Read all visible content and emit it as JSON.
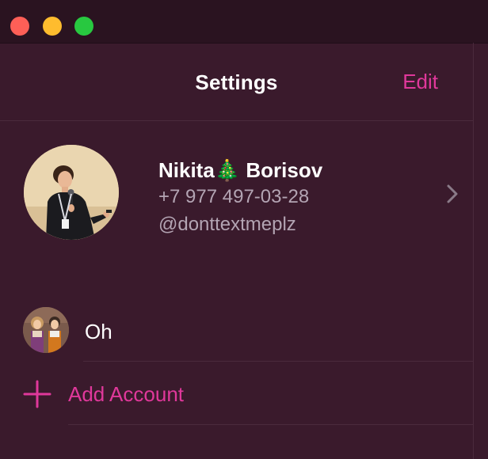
{
  "window": {
    "controls": [
      "close",
      "minimize",
      "maximize"
    ]
  },
  "header": {
    "title": "Settings",
    "edit_label": "Edit"
  },
  "profile": {
    "name": "Nikita🎄 Borisov",
    "phone": "+7 977 497-03-28",
    "username": "@donttextmeplz",
    "avatar_icon": "user-photo",
    "chevron_icon": "chevron-right-icon"
  },
  "accounts": [
    {
      "name": "Oh",
      "avatar_icon": "account-avatar"
    }
  ],
  "add_account": {
    "label": "Add Account",
    "icon": "plus-icon"
  },
  "colors": {
    "background": "#3a1a2c",
    "titlebar": "#2a1320",
    "accent": "#e0389b",
    "secondary_text": "#b3a4b3",
    "separator": "#4a2a3c"
  }
}
